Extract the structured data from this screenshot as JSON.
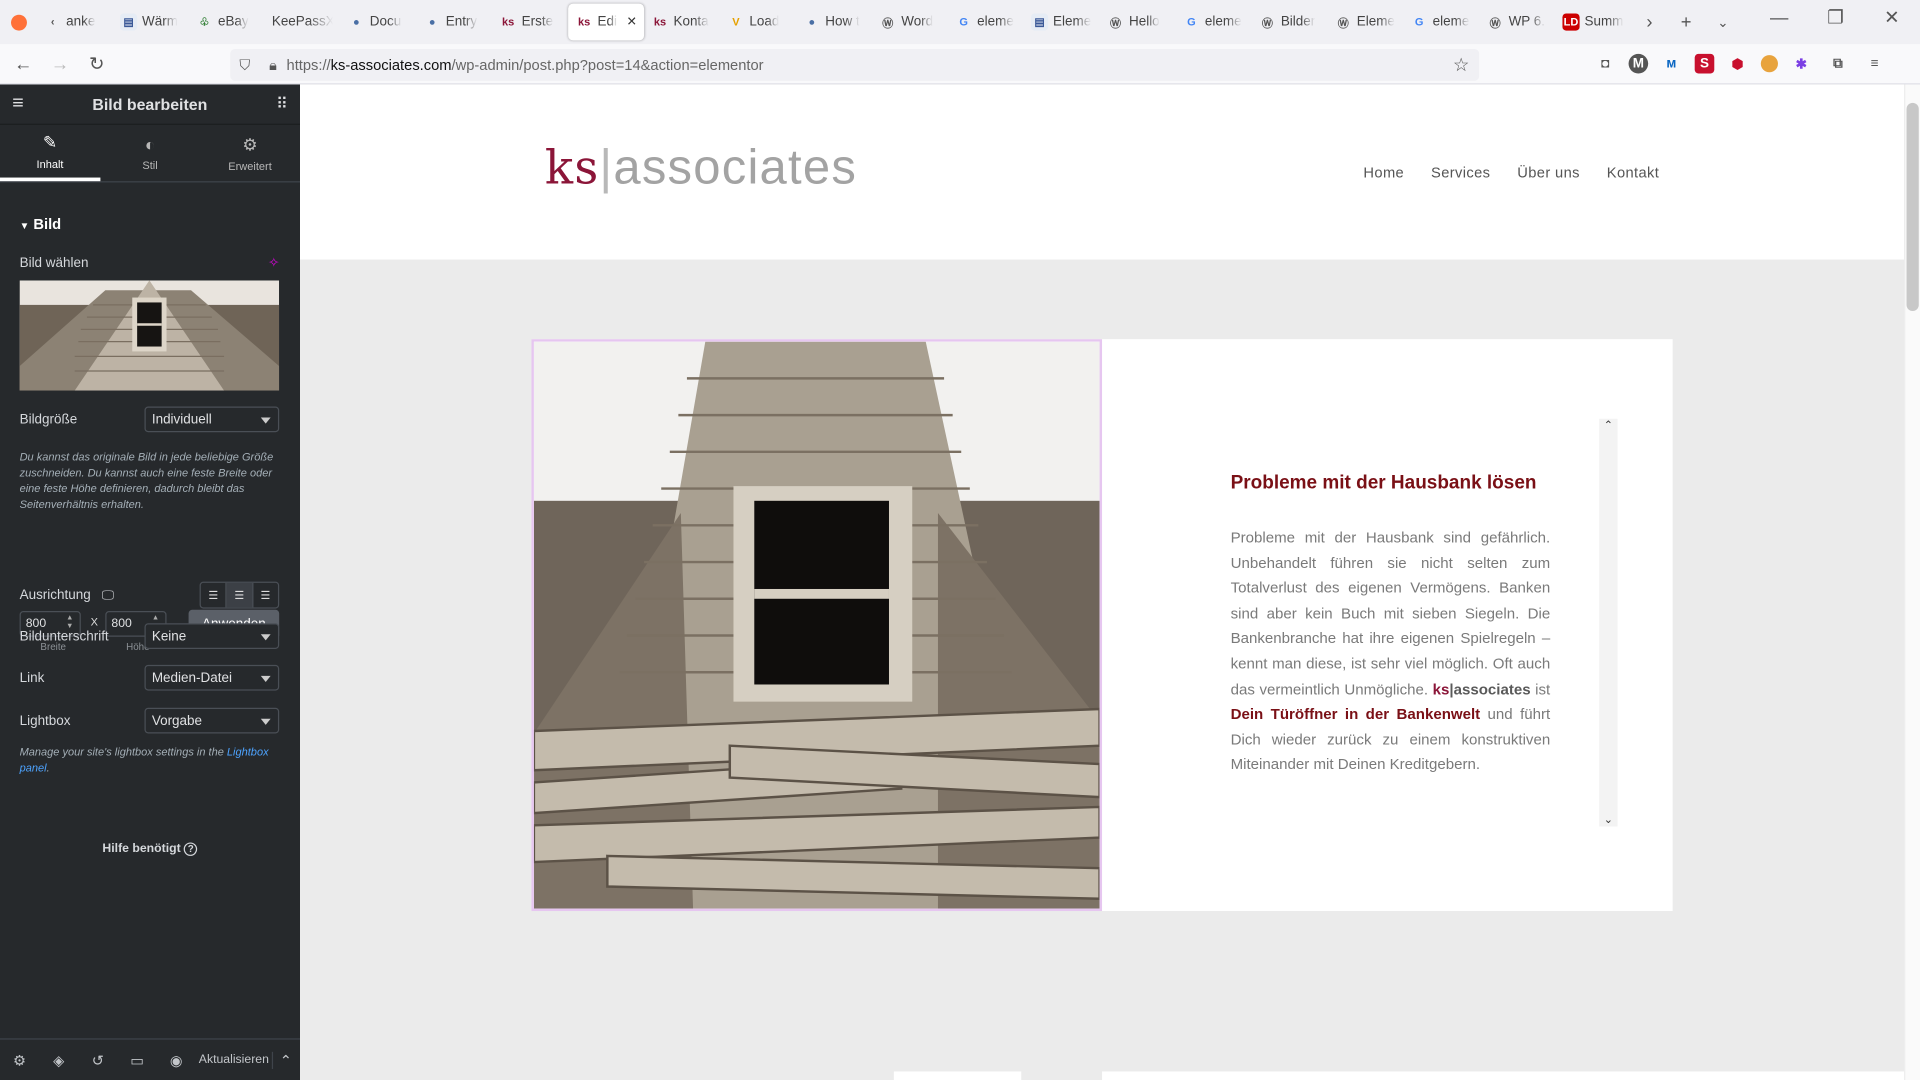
{
  "browser": {
    "tabs": [
      {
        "label": "anke",
        "icon": "chevron-left-icon"
      },
      {
        "label": "Wärm",
        "icon": "page-icon"
      },
      {
        "label": "eBay",
        "icon": "leaf-icon"
      },
      {
        "label": "KeePassXC",
        "icon": ""
      },
      {
        "label": "Docu",
        "icon": "dot-icon"
      },
      {
        "label": "Entry",
        "icon": "dot-icon"
      },
      {
        "label": "Erste",
        "icon": "ks-icon"
      },
      {
        "label": "Edi",
        "icon": "ks-icon"
      },
      {
        "label": "Konta",
        "icon": "ks-icon"
      },
      {
        "label": "Load",
        "icon": "v-icon"
      },
      {
        "label": "How t",
        "icon": "dot-icon"
      },
      {
        "label": "Word",
        "icon": "wordpress-icon"
      },
      {
        "label": "eleme",
        "icon": "google-icon"
      },
      {
        "label": "Eleme",
        "icon": "page-icon"
      },
      {
        "label": "Hello",
        "icon": "wordpress-icon"
      },
      {
        "label": "eleme",
        "icon": "google-icon"
      },
      {
        "label": "Bilder",
        "icon": "wordpress-icon"
      },
      {
        "label": "Eleme",
        "icon": "wordpress-icon"
      },
      {
        "label": "eleme",
        "icon": "google-icon"
      },
      {
        "label": "WP 6.",
        "icon": "wordpress-icon"
      },
      {
        "label": "Summ",
        "icon": "ld-icon"
      }
    ],
    "url_prefix": "https://",
    "url_host": "ks-associates.com",
    "url_path": "/wp-admin/post.php?post=14&action=elementor"
  },
  "panel": {
    "title": "Bild bearbeiten",
    "tabs": [
      "Inhalt",
      "Stil",
      "Erweitert"
    ],
    "section": "Bild",
    "choose_image": "Bild wählen",
    "size_label": "Bildgröße",
    "size_value": "Individuell",
    "size_note": "Du kannst das originale Bild in jede beliebige Größe zuschneiden. Du kannst auch eine feste Breite oder eine feste Höhe definieren, dadurch bleibt das Seitenverhältnis erhalten.",
    "width_value": "800",
    "height_value": "800",
    "x_sep": "X",
    "width_label": "Breite",
    "height_label": "Höhe",
    "apply": "Anwenden",
    "align_label": "Ausrichtung",
    "caption_label": "Bildunterschrift",
    "caption_value": "Keine",
    "link_label": "Link",
    "link_value": "Medien-Datei",
    "lightbox_label": "Lightbox",
    "lightbox_value": "Vorgabe",
    "lightbox_note_prefix": "Manage your site's lightbox settings in the ",
    "lightbox_note_link": "Lightbox panel",
    "lightbox_note_suffix": ".",
    "help": "Hilfe benötigt",
    "update": "Aktualisieren"
  },
  "site": {
    "logo_ks": "ks",
    "logo_bar": "|",
    "logo_rest": "associates",
    "menu": [
      "Home",
      "Services",
      "Über uns",
      "Kontakt"
    ],
    "heading": "Probleme mit der Hausbank lösen",
    "para_1": "Probleme mit der Hausbank sind gefährlich. Unbehandelt führen sie nicht selten zum Totalverlust des eigenen Vermögens. Banken sind aber kein Buch mit sieben Siegeln. Die Bankenbranche hat ihre eigenen Spielregeln – kennt man diese, ist sehr viel möglich. Oft auch das vermeintlich Unmögliche. ",
    "para_brand_ks": "ks",
    "para_brand_rest": "|associates",
    "para_2": " ist ",
    "para_highlight": "Dein Türöffner in der Bankenwelt",
    "para_3": " und führt Dich wieder zurück zu einem konstruktiven Miteinander mit Deinen Kreditgebern."
  },
  "colors": {
    "brand": "#8b1538",
    "heading": "#7a1016",
    "panel_bg": "#26292c",
    "link": "#4da3ff"
  }
}
